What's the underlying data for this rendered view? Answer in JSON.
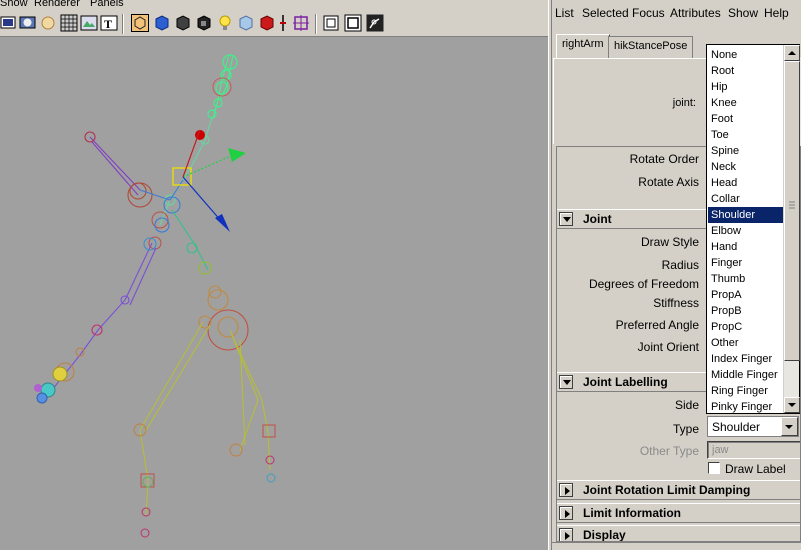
{
  "viewport": {
    "menus": [
      "Show",
      "Renderer",
      "Panels"
    ],
    "toolbar_icons": [
      "wireframe-icon",
      "smooth-shade-icon",
      "lighting-icon",
      "grid-icon",
      "camera-icon",
      "texture-icon",
      "select-camera-icon",
      "shaded-cube-icon",
      "cube-icon",
      "dark-cube-icon",
      "light-icon",
      "glass-cube-icon",
      "red-cube-icon",
      "separator-icon",
      "isolate-icon",
      "wireframe-cube-icon",
      "film-gate-icon",
      "joint-icon"
    ],
    "background_color": "#a0a0a0"
  },
  "attribute_editor": {
    "menus": [
      "List",
      "Selected",
      "Focus",
      "Attributes",
      "Show",
      "Help"
    ],
    "tabs": [
      "rightArm",
      "hikStancePose"
    ],
    "node_label": "joint:",
    "rows": {
      "rotate_order": "Rotate Order",
      "rotate_axis": "Rotate Axis",
      "draw_style": "Draw Style",
      "radius": "Radius",
      "dof": "Degrees of Freedom",
      "stiffness": "Stiffness",
      "preferred_angle": "Preferred Angle",
      "joint_orient": "Joint Orient",
      "side": "Side",
      "type": "Type",
      "other_type": "Other Type"
    },
    "sections": {
      "joint": "Joint",
      "joint_labelling": "Joint Labelling",
      "rotation_limit": "Joint Rotation Limit Damping",
      "limit_info": "Limit Information",
      "display": "Display"
    },
    "type_value": "Shoulder",
    "other_type_value": "jaw",
    "draw_label": "Draw Label"
  },
  "dropdown": {
    "items": [
      "None",
      "Root",
      "Hip",
      "Knee",
      "Foot",
      "Toe",
      "Spine",
      "Neck",
      "Head",
      "Collar",
      "Shoulder",
      "Elbow",
      "Hand",
      "Finger",
      "Thumb",
      "PropA",
      "PropB",
      "PropC",
      "Other",
      "Index Finger",
      "Middle Finger",
      "Ring Finger",
      "Pinky Finger"
    ],
    "selected": "Shoulder",
    "selected_color": "#0a246a"
  }
}
